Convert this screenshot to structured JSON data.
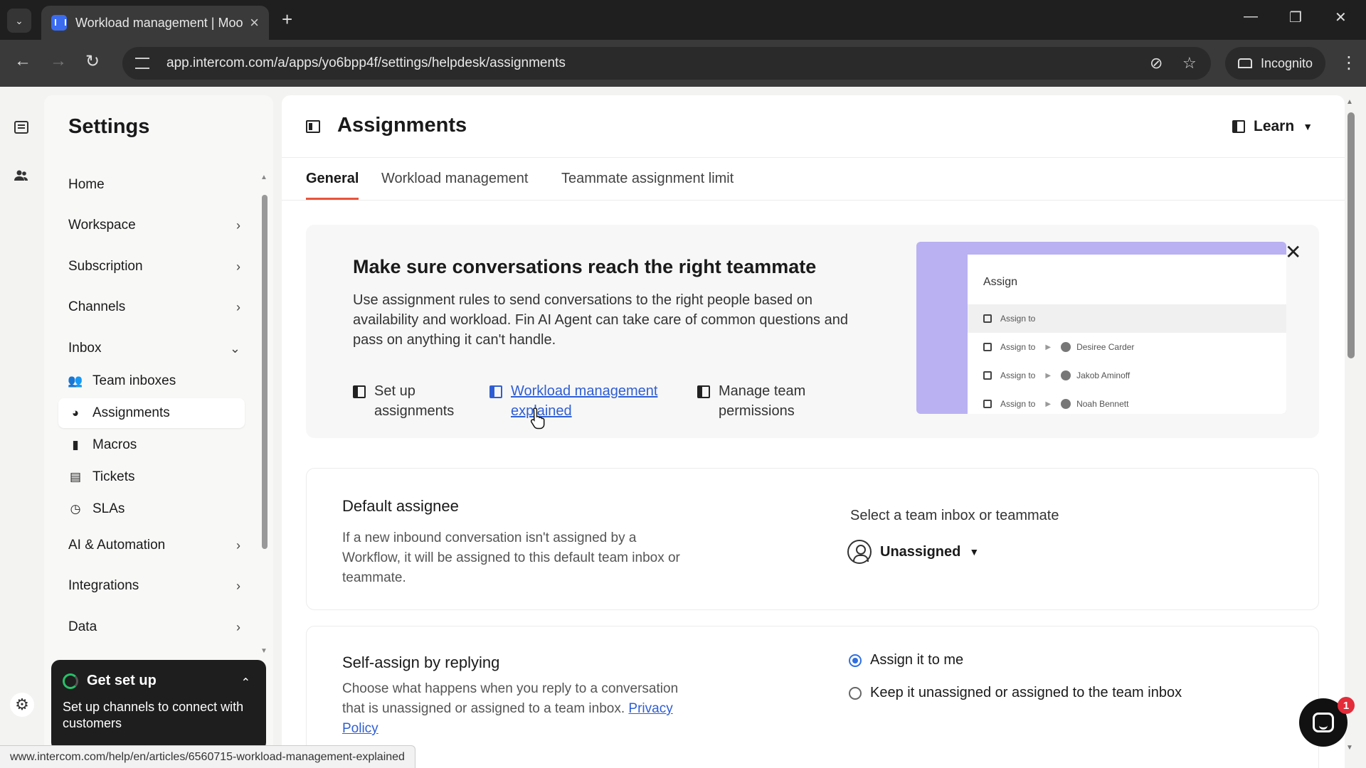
{
  "browser": {
    "tab_title": "Workload management | Moo",
    "url": "app.intercom.com/a/apps/yo6bpp4f/settings/helpdesk/assignments",
    "incognito_label": "Incognito",
    "status_url": "www.intercom.com/help/en/articles/6560715-workload-management-explained"
  },
  "sidebar": {
    "title": "Settings",
    "items": [
      {
        "label": "Home"
      },
      {
        "label": "Workspace"
      },
      {
        "label": "Subscription"
      },
      {
        "label": "Channels"
      },
      {
        "label": "Inbox"
      },
      {
        "label": "AI & Automation"
      },
      {
        "label": "Integrations"
      },
      {
        "label": "Data"
      }
    ],
    "inbox_sub": [
      {
        "label": "Team inboxes",
        "icon": "people-icon"
      },
      {
        "label": "Assignments",
        "icon": "assignment-icon"
      },
      {
        "label": "Macros",
        "icon": "bookmark-icon"
      },
      {
        "label": "Tickets",
        "icon": "ticket-icon"
      },
      {
        "label": "SLAs",
        "icon": "clock-icon"
      }
    ],
    "get_set_up": {
      "title": "Get set up",
      "text": "Set up channels to connect with customers"
    }
  },
  "page": {
    "title": "Assignments",
    "learn_label": "Learn",
    "tabs": [
      {
        "label": "General"
      },
      {
        "label": "Workload management"
      },
      {
        "label": "Teammate assignment limit"
      }
    ]
  },
  "banner": {
    "title": "Make sure conversations reach the right teammate",
    "text": "Use assignment rules to send conversations to the right people based on availability and workload. Fin AI Agent can take care of common questions and pass on anything it can't handle.",
    "links": [
      {
        "label": "Set up assignments"
      },
      {
        "label": "Workload management explained"
      },
      {
        "label": "Manage team permissions"
      }
    ],
    "preview": {
      "search": "Assign",
      "rows": [
        {
          "label": "Assign to",
          "person": ""
        },
        {
          "label": "Assign to",
          "person": "Desiree Carder"
        },
        {
          "label": "Assign to",
          "person": "Jakob Aminoff"
        },
        {
          "label": "Assign to",
          "person": "Noah Bennett"
        }
      ]
    }
  },
  "default_assignee": {
    "title": "Default assignee",
    "desc": "If a new inbound conversation isn't assigned by a Workflow, it will be assigned to this default team inbox or teammate.",
    "field_label": "Select a team inbox or teammate",
    "value": "Unassigned"
  },
  "self_assign": {
    "title": "Self-assign by replying",
    "desc": "Choose what happens when you reply to a conversation that is unassigned or assigned to a team inbox.",
    "link": "Privacy Policy",
    "options": [
      {
        "label": "Assign it to me",
        "selected": true
      },
      {
        "label": "Keep it unassigned or assigned to the team inbox",
        "selected": false
      }
    ]
  },
  "messenger": {
    "badge": "1"
  },
  "colors": {
    "accent_tab": "#e8543b",
    "link": "#2f5ed4",
    "radio": "#2f6fe0"
  }
}
